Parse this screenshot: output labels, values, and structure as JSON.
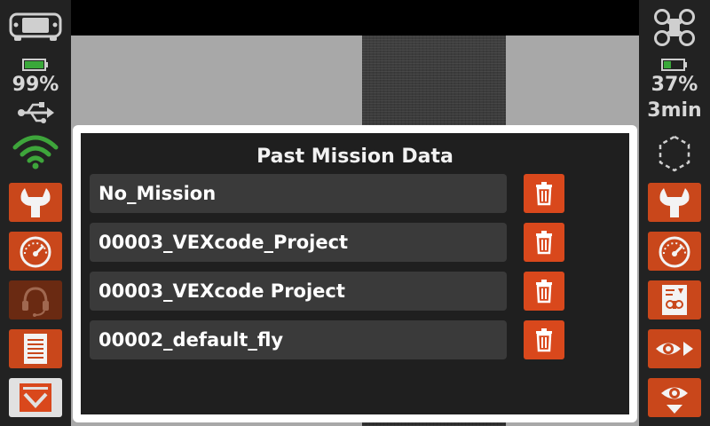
{
  "left_panel": {
    "battery_percent": 99,
    "battery_label": "99%",
    "buttons": [
      "settings",
      "dashboard",
      "support",
      "log",
      "mission-download"
    ]
  },
  "right_panel": {
    "battery_percent": 37,
    "battery_label": "37%",
    "time_label": "3min",
    "buttons": [
      "settings",
      "dashboard",
      "drone-info",
      "view-forward",
      "view-down"
    ]
  },
  "dialog": {
    "title": "Past Mission Data",
    "missions": [
      {
        "name": "No_Mission"
      },
      {
        "name": "00003_VEXcode_Project"
      },
      {
        "name": "00003_VEXcode Project"
      },
      {
        "name": "00002_default_fly"
      }
    ]
  },
  "colors": {
    "accent": "#d9481c",
    "battery_green": "#3aa83a",
    "wifi_green": "#3ea53b",
    "panel_bg": "#222222",
    "row_bg": "#3a3a3a"
  }
}
